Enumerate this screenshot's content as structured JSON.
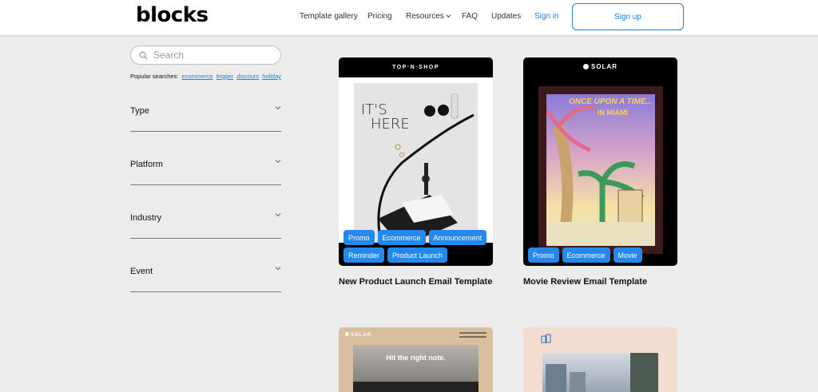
{
  "header": {
    "logo": "blocks",
    "nav": [
      {
        "label": "Template gallery"
      },
      {
        "label": "Pricing"
      },
      {
        "label": "Resources"
      },
      {
        "label": "FAQ"
      },
      {
        "label": "Updates"
      },
      {
        "label": "Sign in"
      }
    ],
    "signup_label": "Sign up"
  },
  "sidebar": {
    "search_placeholder": "Search",
    "popular_label": "Popular searches:",
    "popular_terms": [
      "ecommerce",
      "trigger",
      "discount",
      "holiday"
    ],
    "filters": [
      {
        "label": "Type"
      },
      {
        "label": "Platform"
      },
      {
        "label": "Industry"
      },
      {
        "label": "Event"
      }
    ]
  },
  "templates": [
    {
      "title": "New Product Launch Email Template",
      "brand": "TOP·N·SHOP",
      "headline_line1": "IT'S",
      "headline_line2": "HERE",
      "tags": [
        "Promo",
        "Ecommerce",
        "Announcement",
        "Reminder",
        "Product Launch"
      ]
    },
    {
      "title": "Movie Review Email Template",
      "brand": "SOLAR",
      "poster_line1": "ONCE UPON A TIME...",
      "poster_line2": "IN MIAMI",
      "tags": [
        "Promo",
        "Ecommerce",
        "Movie"
      ]
    },
    {
      "brand": "SOLAR",
      "headline": "Hit the right note."
    },
    {}
  ],
  "colors": {
    "accent": "#1f80e0",
    "tag_bg": "#2489ea",
    "page_bg": "#ececec"
  }
}
